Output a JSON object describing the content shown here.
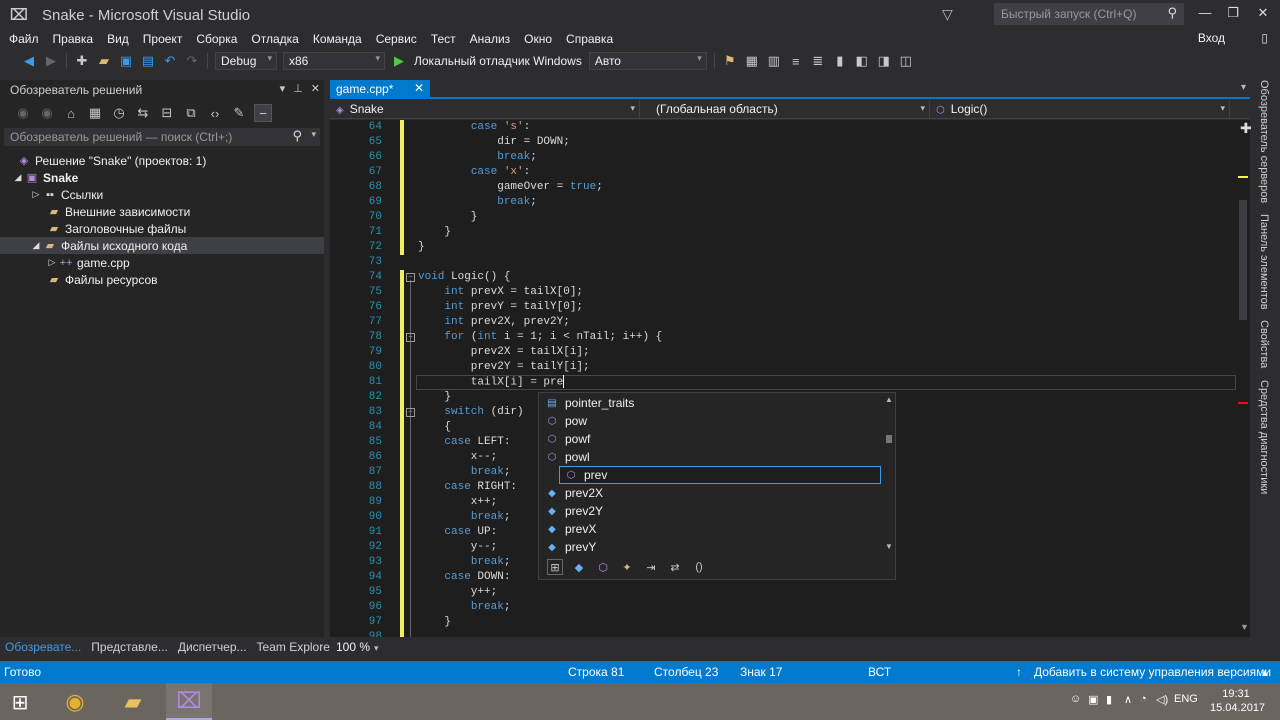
{
  "window": {
    "title": "Snake - Microsoft Visual Studio",
    "quick_launch_placeholder": "Быстрый запуск (Ctrl+Q)",
    "login": "Вход"
  },
  "menu": [
    "Файл",
    "Правка",
    "Вид",
    "Проект",
    "Сборка",
    "Отладка",
    "Команда",
    "Сервис",
    "Тест",
    "Анализ",
    "Окно",
    "Справка"
  ],
  "toolbar": {
    "config": "Debug",
    "platform": "x86",
    "run_label": "Локальный отладчик Windows",
    "run_mode": "Авто"
  },
  "solution_explorer": {
    "title": "Обозреватель решений",
    "search_placeholder": "Обозреватель решений — поиск (Ctrl+;)",
    "nodes": [
      {
        "label": "Решение \"Snake\" (проектов: 1)"
      },
      {
        "label": "Snake"
      },
      {
        "label": "Ссылки"
      },
      {
        "label": "Внешние зависимости"
      },
      {
        "label": "Заголовочные файлы"
      },
      {
        "label": "Файлы исходного кода"
      },
      {
        "label": "game.cpp"
      },
      {
        "label": "Файлы ресурсов"
      }
    ],
    "bottom_tabs": [
      "Обозревате...",
      "Представле...",
      "Диспетчер...",
      "Team Explorer"
    ]
  },
  "editor": {
    "tab": "game.cpp*",
    "nav_project": "Snake",
    "nav_scope": "(Глобальная область)",
    "nav_member": "Logic()",
    "zoom": "100 %",
    "lines": [
      {
        "n": "64",
        "t": "        case 's':"
      },
      {
        "n": "65",
        "t": "            dir = DOWN;"
      },
      {
        "n": "66",
        "t": "            break;"
      },
      {
        "n": "67",
        "t": "        case 'x':"
      },
      {
        "n": "68",
        "t": "            gameOver = true;"
      },
      {
        "n": "69",
        "t": "            break;"
      },
      {
        "n": "70",
        "t": "        }"
      },
      {
        "n": "71",
        "t": "    }"
      },
      {
        "n": "72",
        "t": "}"
      },
      {
        "n": "73",
        "t": ""
      },
      {
        "n": "74",
        "t": "void Logic() {"
      },
      {
        "n": "75",
        "t": "    int prevX = tailX[0];"
      },
      {
        "n": "76",
        "t": "    int prevY = tailY[0];"
      },
      {
        "n": "77",
        "t": "    int prev2X, prev2Y;"
      },
      {
        "n": "78",
        "t": "    for (int i = 1; i < nTail; i++) {"
      },
      {
        "n": "79",
        "t": "        prev2X = tailX[i];"
      },
      {
        "n": "80",
        "t": "        prev2Y = tailY[i];"
      },
      {
        "n": "81",
        "t": "        tailX[i] = pre"
      },
      {
        "n": "82",
        "t": "    }"
      },
      {
        "n": "83",
        "t": "    switch (dir)"
      },
      {
        "n": "84",
        "t": "    {"
      },
      {
        "n": "85",
        "t": "    case LEFT:"
      },
      {
        "n": "86",
        "t": "        x--;"
      },
      {
        "n": "87",
        "t": "        break;"
      },
      {
        "n": "88",
        "t": "    case RIGHT:"
      },
      {
        "n": "89",
        "t": "        x++;"
      },
      {
        "n": "90",
        "t": "        break;"
      },
      {
        "n": "91",
        "t": "    case UP:"
      },
      {
        "n": "92",
        "t": "        y--;"
      },
      {
        "n": "93",
        "t": "        break;"
      },
      {
        "n": "94",
        "t": "    case DOWN:"
      },
      {
        "n": "95",
        "t": "        y++;"
      },
      {
        "n": "96",
        "t": "        break;"
      },
      {
        "n": "97",
        "t": "    }"
      },
      {
        "n": "98",
        "t": ""
      }
    ]
  },
  "intellisense": {
    "items": [
      {
        "label": "pointer_traits",
        "kind": "type"
      },
      {
        "label": "pow",
        "kind": "fn"
      },
      {
        "label": "powf",
        "kind": "fn"
      },
      {
        "label": "powl",
        "kind": "fn"
      },
      {
        "label": "prev",
        "kind": "fn"
      },
      {
        "label": "prev2X",
        "kind": "var"
      },
      {
        "label": "prev2Y",
        "kind": "var"
      },
      {
        "label": "prevX",
        "kind": "var"
      },
      {
        "label": "prevY",
        "kind": "var"
      }
    ],
    "selected_index": 4
  },
  "side_tabs": [
    "Обозреватель серверов",
    "Панель элементов",
    "Свойства",
    "Средства диагностики"
  ],
  "status": {
    "ready": "Готово",
    "row": "Строка 81",
    "col": "Столбец 23",
    "char": "Знак 17",
    "mode": "ВСТ",
    "vcs": "Добавить в систему управления версиями"
  },
  "taskbar": {
    "lang": "ENG",
    "time": "19:31",
    "date": "15.04.2017"
  },
  "colors": {
    "accent": "#007acc",
    "keyword": "#569cd6",
    "string": "#d69d85",
    "line_number": "#2b91af"
  }
}
